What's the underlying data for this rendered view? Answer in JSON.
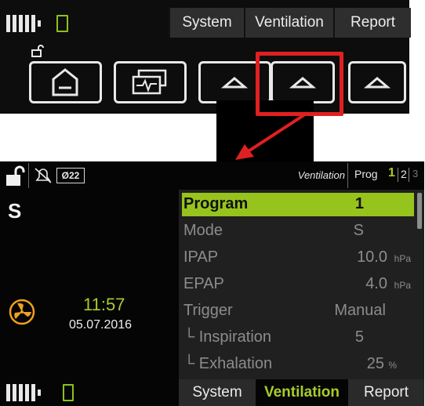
{
  "top": {
    "tabs": [
      "System",
      "Ventilation",
      "Report"
    ]
  },
  "screen": {
    "header": {
      "alarm_counter": "Ø22",
      "mode_label": "Ventilation",
      "prog_label": "Prog",
      "prog_pages": [
        "1",
        "2",
        "3"
      ]
    },
    "left": {
      "mode_letter": "S",
      "time": "11:57",
      "date": "05.07.2016"
    },
    "settings": [
      {
        "label": "Program",
        "value": "1",
        "unit": ""
      },
      {
        "label": "Mode",
        "value": "S",
        "unit": ""
      },
      {
        "label": "IPAP",
        "value": "10.0",
        "unit": "hPa"
      },
      {
        "label": "EPAP",
        "value": "4.0",
        "unit": "hPa"
      },
      {
        "label": "Trigger",
        "value": "Manual",
        "unit": ""
      },
      {
        "label": "└ Inspiration",
        "value": "5",
        "unit": ""
      },
      {
        "label": "└ Exhalation",
        "value": "25",
        "unit": "%"
      }
    ],
    "footer_tabs": [
      "System",
      "Ventilation",
      "Report"
    ]
  },
  "colors": {
    "accent_green": "#97c41c",
    "highlight_red": "#e02020",
    "fan_orange": "#f0a020"
  }
}
